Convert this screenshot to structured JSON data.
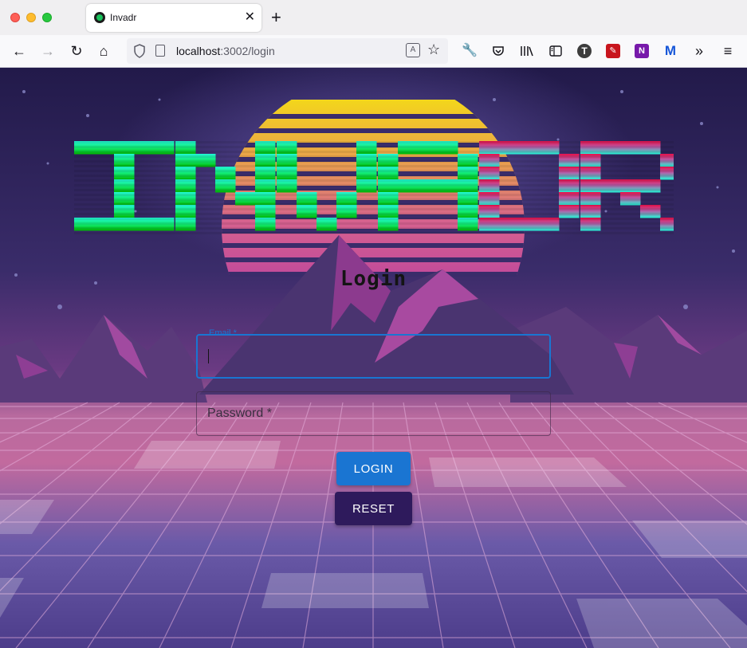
{
  "browser": {
    "tab_title": "Invadr",
    "new_tab": "+",
    "url_host": "localhost",
    "url_rest": ":3002/login",
    "toolbar_icons": [
      "back-icon",
      "forward-icon",
      "reload-icon",
      "home-icon",
      "shield-icon",
      "translate-icon",
      "star-icon",
      "wrench-icon",
      "pocket-icon",
      "library-icon",
      "sidebar-icon",
      "t-extension-icon",
      "lastpass-icon",
      "onenote-icon",
      "malwarebytes-icon",
      "overflow-icon",
      "menu-icon"
    ]
  },
  "page": {
    "logo_text": "INVADR",
    "heading": "Login",
    "email_label": "Email",
    "password_label": "Password",
    "required_marker": "*",
    "login_button": "LOGIN",
    "reset_button": "RESET"
  },
  "colors": {
    "accent": "#1976d2",
    "login_button": "#1a75d2",
    "reset_button": "#2e1a5c",
    "logo_top": "#22f7d6",
    "logo_bottom": "#00b400",
    "logo_accent": "#e8104a"
  }
}
